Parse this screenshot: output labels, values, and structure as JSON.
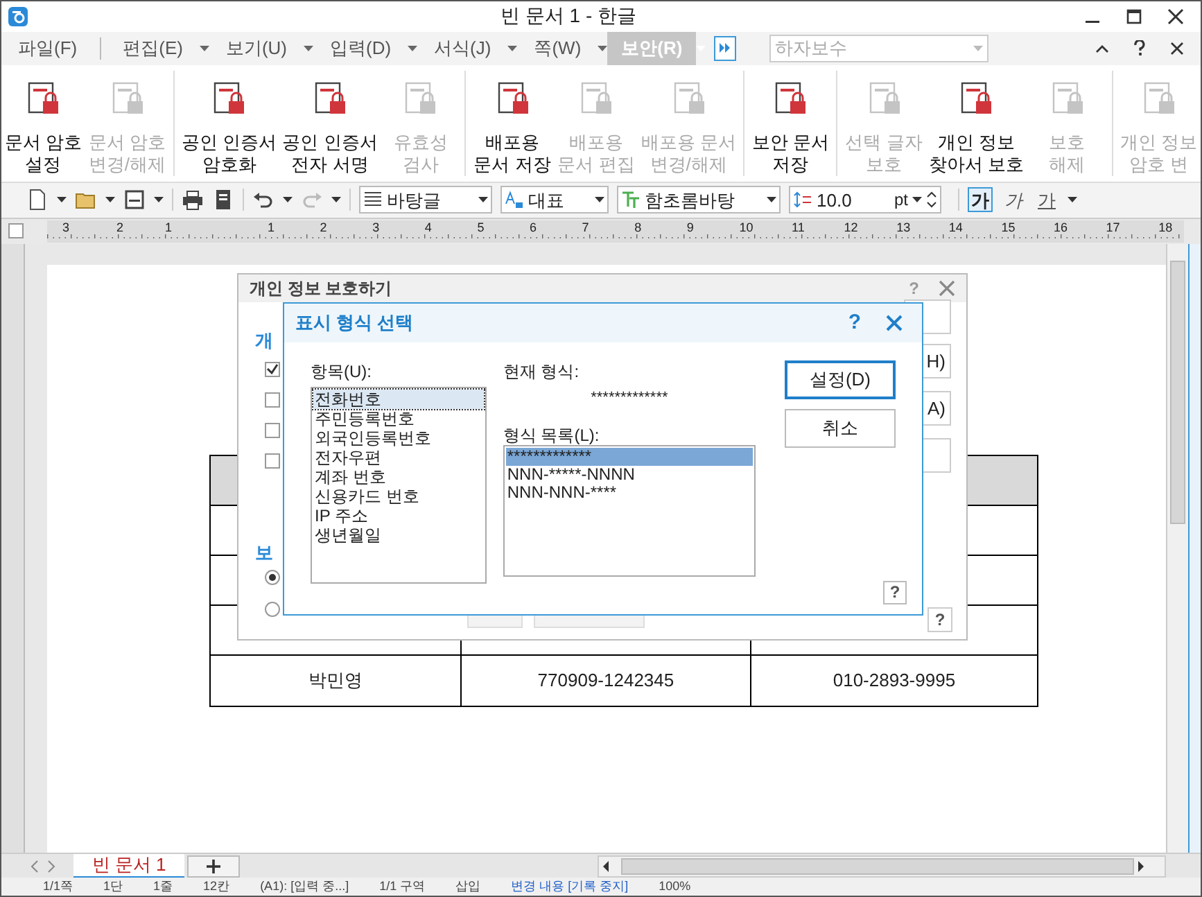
{
  "window": {
    "title": "빈 문서 1 - 한글"
  },
  "menu_tabs": [
    {
      "label": "파일(F)",
      "selected": false,
      "caret": false
    },
    {
      "label": "편집(E)",
      "selected": false,
      "caret": true
    },
    {
      "label": "보기(U)",
      "selected": false,
      "caret": true
    },
    {
      "label": "입력(D)",
      "selected": false,
      "caret": true
    },
    {
      "label": "서식(J)",
      "selected": false,
      "caret": true
    },
    {
      "label": "쪽(W)",
      "selected": false,
      "caret": true
    },
    {
      "label": "보안(R)",
      "selected": true,
      "caret": true
    }
  ],
  "style_box": {
    "value": "하자보수",
    "disabled": true
  },
  "ribbon_groups": [
    [
      {
        "lines": [
          "문서 암호",
          "설정"
        ],
        "disabled": false
      },
      {
        "lines": [
          "문서 암호",
          "변경/해제"
        ],
        "disabled": true
      }
    ],
    [
      {
        "lines": [
          "공인 인증서",
          "암호화"
        ],
        "disabled": false
      },
      {
        "lines": [
          "공인 인증서",
          "전자 서명"
        ],
        "disabled": false
      },
      {
        "lines": [
          "유효성",
          "검사"
        ],
        "disabled": true
      }
    ],
    [
      {
        "lines": [
          "배포용",
          "문서 저장"
        ],
        "disabled": false
      },
      {
        "lines": [
          "배포용",
          "문서 편집"
        ],
        "disabled": true
      },
      {
        "lines": [
          "배포용 문서",
          "변경/해제"
        ],
        "disabled": true
      }
    ],
    [
      {
        "lines": [
          "보안 문서",
          "저장"
        ],
        "disabled": false
      }
    ],
    [
      {
        "lines": [
          "선택 글자",
          "보호"
        ],
        "disabled": true
      },
      {
        "lines": [
          "개인 정보",
          "찾아서 보호"
        ],
        "disabled": false
      },
      {
        "lines": [
          "보호",
          "해제"
        ],
        "disabled": true
      }
    ],
    [
      {
        "lines": [
          "개인 정보",
          "암호 변"
        ],
        "disabled": true
      }
    ]
  ],
  "toolbar": {
    "paragraph_style": "바탕글",
    "language": "대표",
    "font": "함초롬바탕",
    "size": "10.0",
    "unit": "pt",
    "char_styles": [
      {
        "label": "가",
        "kind": "bold",
        "selected": true
      },
      {
        "label": "가",
        "kind": "italic",
        "selected": false
      },
      {
        "label": "가",
        "kind": "underline",
        "selected": false
      }
    ]
  },
  "ruler_labels": [
    "3",
    "2",
    "1",
    "1",
    "2",
    "3",
    "4",
    "5",
    "6",
    "7",
    "8",
    "9",
    "10",
    "11",
    "12",
    "13",
    "14",
    "15",
    "16",
    "17",
    "18"
  ],
  "table": {
    "rows": [
      [
        "박민영",
        "770909-1242345",
        "010-2893-9995"
      ]
    ]
  },
  "back_dialog": {
    "title": "개인 정보 보호하기",
    "help_top": "?",
    "help_bottom": "?",
    "heading": "개",
    "section": "보",
    "checkboxes": [
      {
        "checked": true
      },
      {
        "checked": false
      },
      {
        "checked": false
      },
      {
        "checked": false
      }
    ],
    "button_fragments": [
      "H)",
      "A)"
    ],
    "radios": [
      {
        "selected": true
      },
      {
        "selected": false
      }
    ]
  },
  "front_dialog": {
    "title": "표시 형식 선택",
    "help_top": "?",
    "help_bottom": "?",
    "items_label": "항목(U):",
    "items": [
      {
        "label": "전화번호",
        "selected": true
      },
      {
        "label": "주민등록번호",
        "selected": false
      },
      {
        "label": "외국인등록번호",
        "selected": false
      },
      {
        "label": "전자우편",
        "selected": false
      },
      {
        "label": "계좌 번호",
        "selected": false
      },
      {
        "label": "신용카드 번호",
        "selected": false
      },
      {
        "label": "IP 주소",
        "selected": false
      },
      {
        "label": "생년월일",
        "selected": false
      }
    ],
    "current_label": "현재 형식:",
    "current_value": "*************",
    "formats_label": "형식 목록(L):",
    "formats": [
      {
        "label": "*************",
        "selected": true
      },
      {
        "label": "NNN-*****-NNNN",
        "selected": false
      },
      {
        "label": "NNN-NNN-****",
        "selected": false
      }
    ],
    "buttons": [
      {
        "label": "설정(D)",
        "focused": true
      },
      {
        "label": "취소",
        "focused": false
      }
    ]
  },
  "doc_tabs": [
    {
      "label": "빈 문서 1",
      "selected": true
    }
  ],
  "status_bar": [
    "1/1쪽",
    "1단",
    "1줄",
    "12칸",
    "(A1): [입력 중...]",
    "1/1 구역",
    "삽입",
    "변경 내용 [기록 중지]",
    "100%"
  ]
}
